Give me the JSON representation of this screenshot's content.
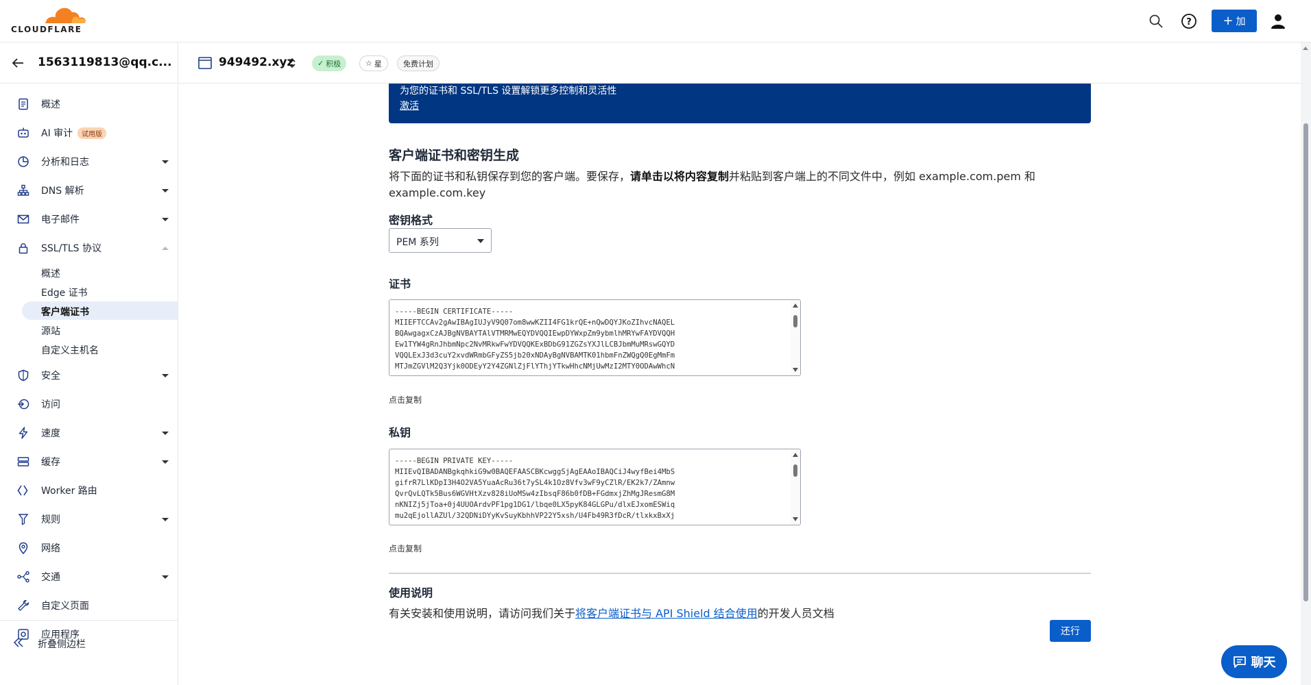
{
  "topbar": {
    "logo_text": "CLOUDFLARE",
    "add_label": "加",
    "accent": "#0a5ec9",
    "icons": [
      "search-icon",
      "help-icon",
      "plus-icon",
      "user-icon"
    ]
  },
  "account": {
    "name": "1563119813@qq.c..."
  },
  "sidebar": {
    "items": [
      {
        "label": "概述",
        "icon": "document-icon",
        "caret": false
      },
      {
        "label": "AI 审计",
        "icon": "robot-icon",
        "badge": "试用版",
        "caret": false
      },
      {
        "label": "分析和日志",
        "icon": "chart-pie-icon",
        "caret": true
      },
      {
        "label": "DNS 解析",
        "icon": "network-icon",
        "caret": true
      },
      {
        "label": "电子邮件",
        "icon": "mail-icon",
        "caret": true
      },
      {
        "label": "SSL/TLS 协议",
        "icon": "lock-icon",
        "caret": "up"
      },
      {
        "label": "安全",
        "icon": "shield-icon",
        "caret": true
      },
      {
        "label": "访问",
        "icon": "access-icon",
        "caret": false
      },
      {
        "label": "速度",
        "icon": "bolt-icon",
        "caret": true
      },
      {
        "label": "缓存",
        "icon": "storage-icon",
        "caret": true
      },
      {
        "label": "Worker 路由",
        "icon": "worker-icon",
        "caret": false
      },
      {
        "label": "规则",
        "icon": "rules-icon",
        "caret": true
      },
      {
        "label": "网络",
        "icon": "location-pin-icon",
        "caret": false
      },
      {
        "label": "交通",
        "icon": "traffic-icon",
        "caret": true
      },
      {
        "label": "自定义页面",
        "icon": "wrench-icon",
        "caret": false
      },
      {
        "label": "应用程序",
        "icon": "apps-icon",
        "caret": false
      }
    ],
    "ssl_sub_items": [
      {
        "label": "概述",
        "active": false
      },
      {
        "label": "Edge 证书",
        "active": false
      },
      {
        "label": "客户端证书",
        "active": true
      },
      {
        "label": "源站",
        "active": false
      },
      {
        "label": "自定义主机名",
        "active": false
      }
    ],
    "collapse_label": "折叠侧边栏"
  },
  "zone": {
    "name": "949492.xyz",
    "status_badge": "积极",
    "star_label": "星",
    "plan_label": "免费计划"
  },
  "banner": {
    "text": "为您的证书和 SSL/TLS 设置解锁更多控制和灵活性",
    "link": "激活"
  },
  "main": {
    "title": "客户端证书和密钥生成",
    "desc_part1": "将下面的证书和私钥保存到您的客户端。要保存，",
    "desc_bold": "请单击以将内容复制",
    "desc_part2": "并粘贴到客户端上的不同文件中，例如 example.com.pem 和 example.com.key",
    "key_format_label": "密钥格式",
    "key_format_value": "PEM 系列",
    "certificate_label": "证书",
    "certificate_text": "-----BEGIN CERTIFICATE-----\nMIIEFTCCAv2gAwIBAgIUJyV9Q07om8wwKZII4FG1krQE+nQwDQYJKoZIhvcNAQEL\nBQAwgagxCzAJBgNVBAYTAlVTMRMwEQYDVQQIEwpDYWxpZm9ybmlhMRYwFAYDVQQH\nEw1TYW4gRnJhbmNpc2NvMRkwFwYDVQQKExBDbG91ZGZsYXJlLCBJbmMuMRswGQYD\nVQQLExJ3d3cuY2xvdWRmbGFyZS5jb20xNDAyBgNVBAMTK01hbmFnZWQgQ0EgMmFm\nMTJmZGVlM2Q3Yjk0ODEyY2Y4ZGNlZjFlYThjYTkwHhcNMjUwMzI2MTY0ODAwWhcN",
    "copy_hint_1": "点击复制",
    "private_key_label": "私钥",
    "private_key_text": "-----BEGIN PRIVATE KEY-----\nMIIEvQIBADANBgkqhkiG9w0BAQEFAASCBKcwggSjAgEAAoIBAQCiJ4wyfBei4MbS\ngifrR7LlKDpI3H4O2VA5YuaAcRu36t7ySL4k1Oz8Vfv3wF9yCZlR/EK2k7/ZAmnw\nQvrQvLQTk5Bus6WGVHtXzv828iUoMSw4zIbsqF86b0fDB+FGdmxjZhMgJResmG8M\nnKNIZj5jToa+0j4UUOArdvPF1pg1DG1/lbqe0LX5pyK84GLGPu/dlxEJxomESWiq\nmu2qEjollAZUl/32QDNiDYyKvSuyKbhhVP22Y5xsh/U4Fb49R3fDcR/tlxkxBxXj",
    "copy_hint_2": "点击复制",
    "usage_title": "使用说明",
    "usage_text_1": "有关安装和使用说明，请访问我们关于",
    "usage_link": "将客户端证书与 API Shield 结合使用",
    "usage_text_2": "的开发人员文档",
    "return_label": "还行"
  },
  "chat": {
    "label": "聊天"
  }
}
